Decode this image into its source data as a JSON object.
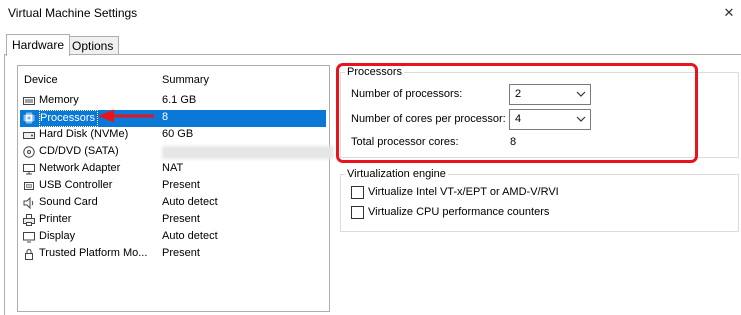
{
  "window": {
    "title": "Virtual Machine Settings",
    "close_icon": "close-icon"
  },
  "tabs": [
    {
      "label": "Hardware",
      "active": true
    },
    {
      "label": "Options",
      "active": false
    }
  ],
  "device_list": {
    "headers": {
      "device": "Device",
      "summary": "Summary"
    },
    "items": [
      {
        "name": "Memory",
        "summary": "6.1 GB",
        "icon": "memory-icon"
      },
      {
        "name": "Processors",
        "summary": "8",
        "icon": "processor-icon",
        "selected": true
      },
      {
        "name": "Hard Disk (NVMe)",
        "summary": "60 GB",
        "icon": "hard-disk-icon"
      },
      {
        "name": "CD/DVD (SATA)",
        "summary": "",
        "icon": "cd-dvd-icon"
      },
      {
        "name": "Network Adapter",
        "summary": "NAT",
        "icon": "network-adapter-icon"
      },
      {
        "name": "USB Controller",
        "summary": "Present",
        "icon": "usb-controller-icon"
      },
      {
        "name": "Sound Card",
        "summary": "Auto detect",
        "icon": "sound-card-icon"
      },
      {
        "name": "Printer",
        "summary": "Present",
        "icon": "printer-icon"
      },
      {
        "name": "Display",
        "summary": "Auto detect",
        "icon": "display-icon"
      },
      {
        "name": "Trusted Platform Mo...",
        "summary": "Present",
        "icon": "tpm-icon"
      }
    ]
  },
  "processors": {
    "group_label": "Processors",
    "num_processors": {
      "label": "Number of processors:",
      "value": "2"
    },
    "cores_per_processor": {
      "label": "Number of cores per processor:",
      "value": "4"
    },
    "total_cores": {
      "label": "Total processor cores:",
      "value": "8"
    }
  },
  "virtualization": {
    "group_label": "Virtualization engine",
    "options": [
      {
        "label": "Virtualize Intel VT-x/EPT or AMD-V/RVI",
        "checked": false
      },
      {
        "label": "Virtualize CPU performance counters",
        "checked": false
      }
    ]
  },
  "colors": {
    "selection": "#0a78d7",
    "highlight": "#e8141c",
    "annotation_arrow": "#e8141c"
  }
}
